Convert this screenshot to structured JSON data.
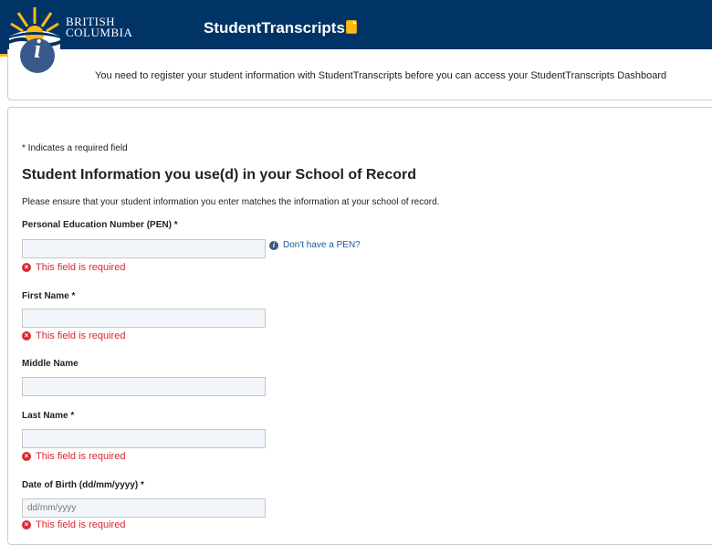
{
  "header": {
    "logo_line1": "British",
    "logo_line2": "Columbia",
    "app_title": "StudentTranscripts"
  },
  "info": {
    "message": "You need to register your student information with StudentTranscripts before you can access your StudentTranscripts Dashboard"
  },
  "form": {
    "required_note": "* Indicates a required field",
    "section_title": "Student Information you use(d) in your School of Record",
    "section_desc": "Please ensure that your student information you enter matches the information at your school of record.",
    "pen": {
      "label": "Personal Education Number (PEN) *",
      "value": "",
      "help_link": "Don't have a PEN?",
      "error": "This field is required"
    },
    "first_name": {
      "label": "First Name *",
      "value": "",
      "error": "This field is required"
    },
    "middle_name": {
      "label": "Middle Name",
      "value": ""
    },
    "last_name": {
      "label": "Last Name *",
      "value": "",
      "error": "This field is required"
    },
    "dob": {
      "label": "Date of Birth (dd/mm/yyyy) *",
      "value": "",
      "placeholder": "dd/mm/yyyy",
      "error": "This field is required"
    }
  },
  "icons": {
    "error": "error-x-icon",
    "help": "info-icon",
    "doc": "document-icon",
    "logo": "bc-sun-logo"
  },
  "colors": {
    "header_bg": "#003366",
    "header_accent": "#fcba19",
    "error": "#d8292f",
    "link": "#1a5a96"
  }
}
